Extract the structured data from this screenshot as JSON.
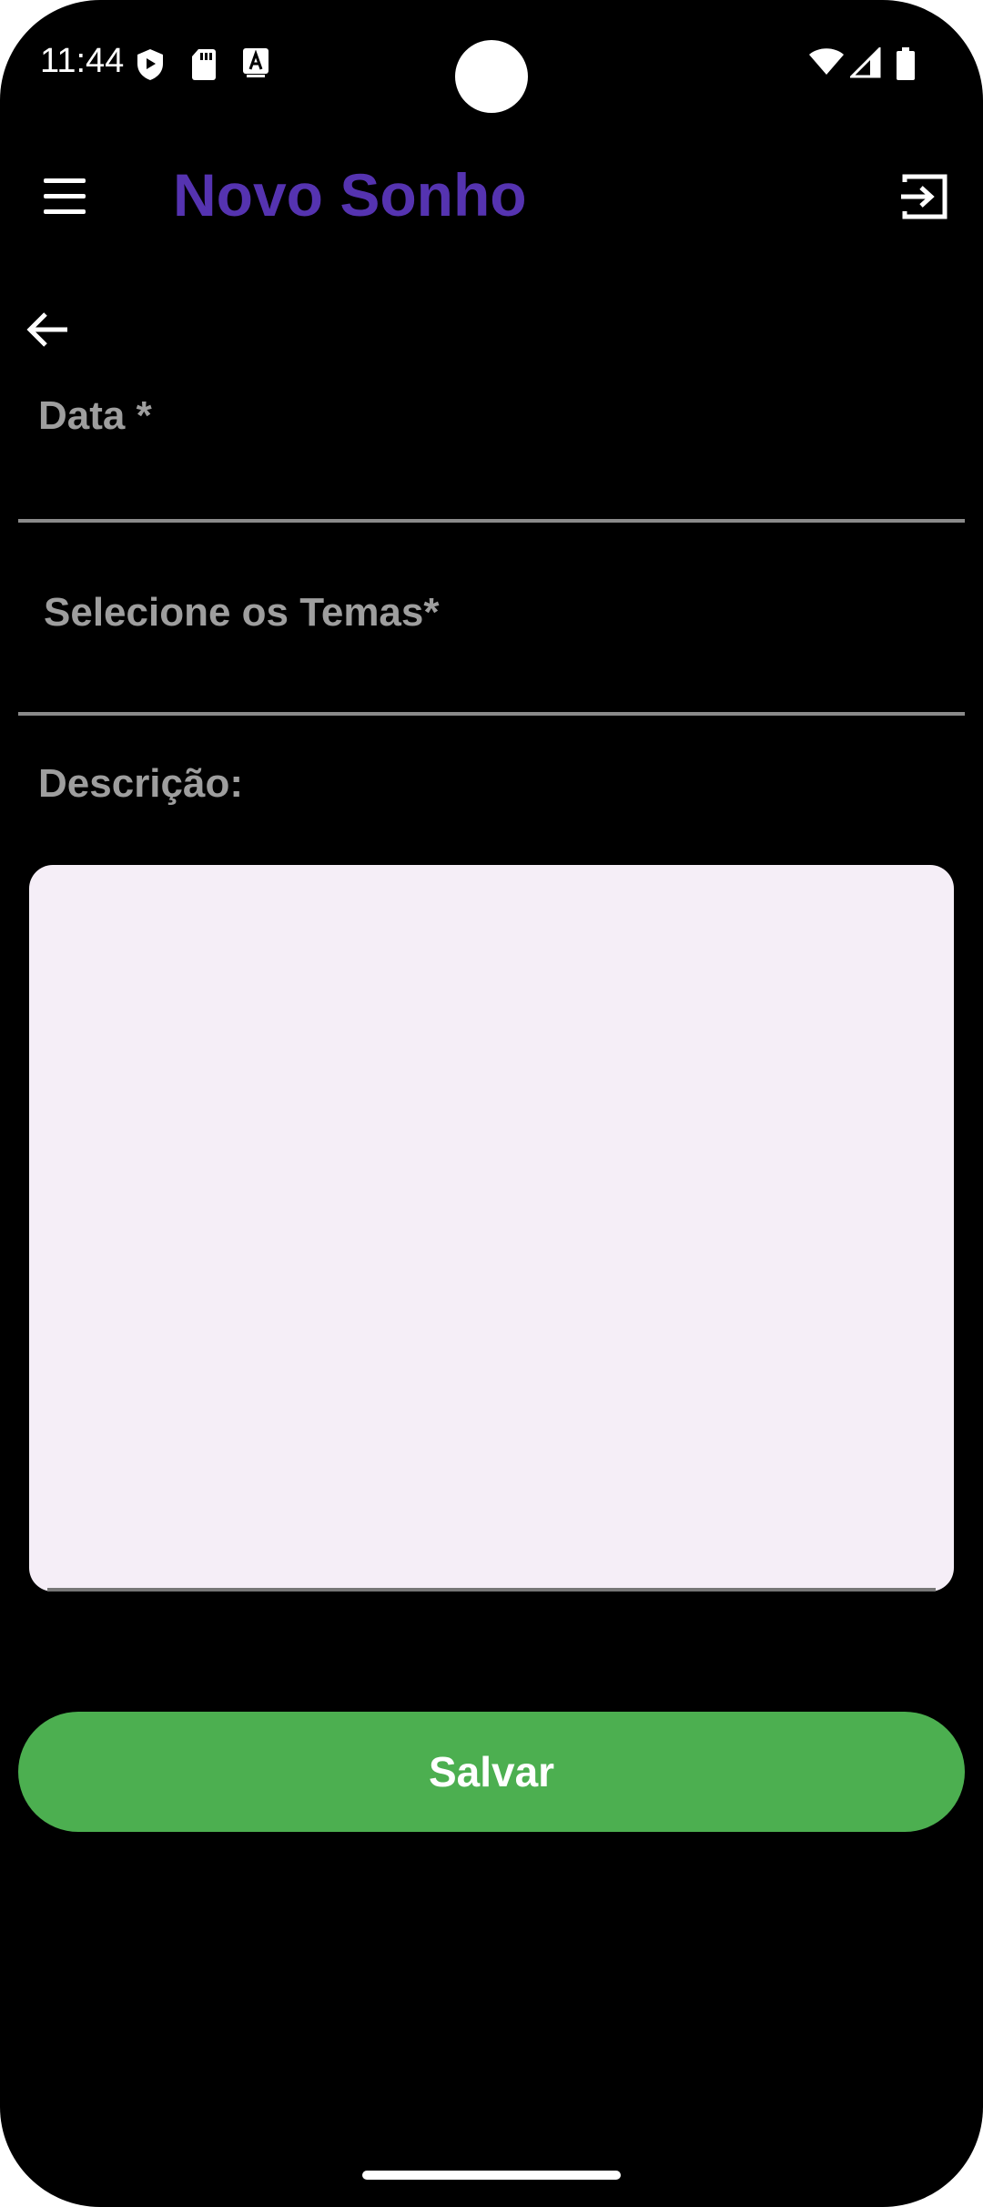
{
  "status_bar": {
    "time": "11:44",
    "icons": [
      "shield-icon",
      "sd-card-icon",
      "keyboard-a-icon",
      "wifi-icon",
      "signal-icon",
      "battery-icon"
    ]
  },
  "app_bar": {
    "title": "Novo Sonho",
    "title_color": "#5533b0",
    "menu_icon": "hamburger-menu-icon",
    "logout_icon": "logout-icon"
  },
  "form": {
    "back_icon": "arrow-back-icon",
    "date_label": "Data *",
    "themes_label": "Selecione os Temas*",
    "description_label": "Descrição:",
    "description_value": ""
  },
  "actions": {
    "save_label": "Salvar",
    "save_color": "#4caf50"
  }
}
